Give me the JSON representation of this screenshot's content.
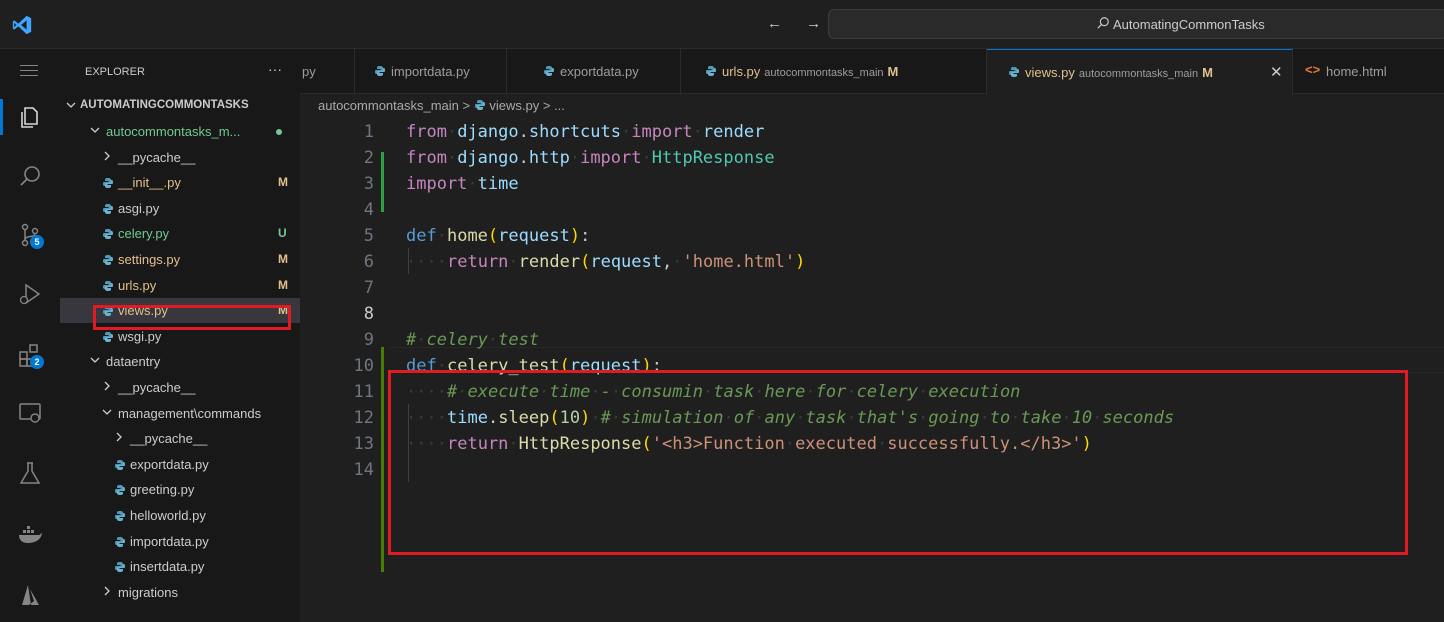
{
  "titlebar": {
    "nav_arrows": "← →",
    "search_text": "AutomatingCommonTasks"
  },
  "activity_bar": {
    "items": [
      {
        "icon": "files-icon",
        "active": true
      },
      {
        "icon": "search-icon"
      },
      {
        "icon": "source-control-icon",
        "badge": "5"
      },
      {
        "icon": "run-debug-icon"
      },
      {
        "icon": "extensions-icon",
        "badge": "2"
      },
      {
        "icon": "remote-explorer-icon"
      },
      {
        "icon": "testing-icon"
      },
      {
        "icon": "docker-icon"
      },
      {
        "icon": "azure-icon"
      }
    ]
  },
  "sidebar": {
    "title": "EXPLORER",
    "more": "···",
    "root": "AUTOMATINGCOMMONTASKS",
    "tree": [
      {
        "label": "autocommontasks_m...",
        "type": "folder-open",
        "indent": 1,
        "color": "untracked",
        "dot": true
      },
      {
        "label": "__pycache__",
        "type": "folder",
        "indent": 2
      },
      {
        "label": "__init__.py",
        "type": "py",
        "indent": 2,
        "status": "M"
      },
      {
        "label": "asgi.py",
        "type": "py",
        "indent": 2
      },
      {
        "label": "celery.py",
        "type": "py",
        "indent": 2,
        "status": "U"
      },
      {
        "label": "settings.py",
        "type": "py",
        "indent": 2,
        "status": "M"
      },
      {
        "label": "urls.py",
        "type": "py",
        "indent": 2,
        "status": "M"
      },
      {
        "label": "views.py",
        "type": "py",
        "indent": 2,
        "status": "M",
        "selected": true
      },
      {
        "label": "wsgi.py",
        "type": "py",
        "indent": 2
      },
      {
        "label": "dataentry",
        "type": "folder-open",
        "indent": 1
      },
      {
        "label": "__pycache__",
        "type": "folder",
        "indent": 2
      },
      {
        "label": "management\\commands",
        "type": "folder-open",
        "indent": 2
      },
      {
        "label": "__pycache__",
        "type": "folder",
        "indent": 3
      },
      {
        "label": "exportdata.py",
        "type": "py",
        "indent": 3
      },
      {
        "label": "greeting.py",
        "type": "py",
        "indent": 3
      },
      {
        "label": "helloworld.py",
        "type": "py",
        "indent": 3
      },
      {
        "label": "importdata.py",
        "type": "py",
        "indent": 3
      },
      {
        "label": "insertdata.py",
        "type": "py",
        "indent": 3
      },
      {
        "label": "migrations",
        "type": "folder",
        "indent": 2
      }
    ]
  },
  "tabs": [
    {
      "name": "py",
      "partial": true
    },
    {
      "name": "importdata.py"
    },
    {
      "name": "exportdata.py"
    },
    {
      "name": "urls.py",
      "desc": "autocommontasks_main",
      "mark": "M"
    },
    {
      "name": "views.py",
      "desc": "autocommontasks_main",
      "mark": "M",
      "active": true,
      "close": "✕"
    },
    {
      "name": "home.html",
      "type": "html"
    }
  ],
  "breadcrumb": {
    "folder": "autocommontasks_main",
    "sep": ">",
    "file": "views.py",
    "rest": "> ..."
  },
  "editor": {
    "language": "python",
    "current_line": 8,
    "lines": [
      "from django.shortcuts import render",
      "from django.http import HttpResponse",
      "import time",
      "",
      "def home(request):",
      "    return render(request, 'home.html')",
      "",
      "",
      "# celery test",
      "def celery_test(request):",
      "    # execute time - consumin task here for celery execution",
      "    time.sleep(10) # simulation of any task that's going to take 10 seconds",
      "    return HttpResponse('<h3>Function executed successfully.</h3>')",
      ""
    ]
  },
  "colors": {
    "accent": "#0078d4",
    "highlight_box": "#e01b24",
    "modified": "#e2c08d",
    "untracked": "#73c991",
    "python_icon": "#519aba",
    "html_icon": "#e37933"
  }
}
